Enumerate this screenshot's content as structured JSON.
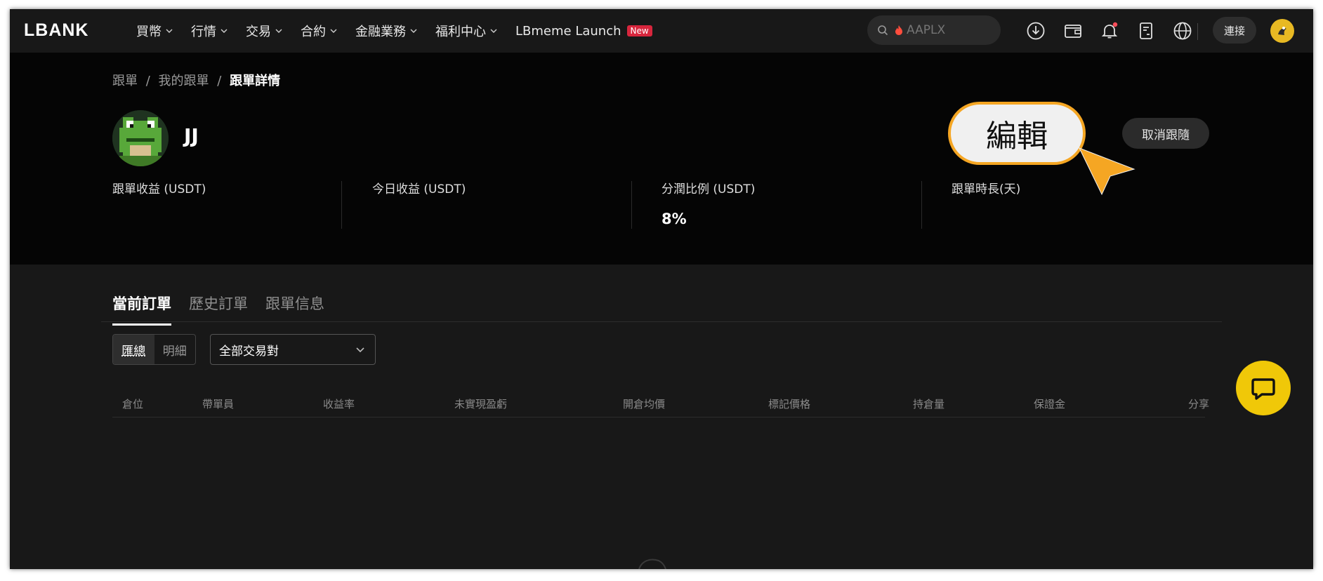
{
  "nav": {
    "logo": "LBANK",
    "menu": [
      {
        "label": "買幣",
        "has_dropdown": true
      },
      {
        "label": "行情",
        "has_dropdown": true
      },
      {
        "label": "交易",
        "has_dropdown": true
      },
      {
        "label": "合約",
        "has_dropdown": true
      },
      {
        "label": "金融業務",
        "has_dropdown": true
      },
      {
        "label": "福利中心",
        "has_dropdown": true
      },
      {
        "label": "LBmeme Launch",
        "has_dropdown": false,
        "badge": "New"
      }
    ],
    "search_placeholder": "AAPLX",
    "connect_label": "連接",
    "icons": [
      "download-icon",
      "wallet-icon",
      "bell-icon",
      "document-icon",
      "globe-icon"
    ]
  },
  "breadcrumb": {
    "items": [
      "跟單",
      "我的跟單",
      "跟單詳情"
    ],
    "separator": "/"
  },
  "trader": {
    "name": "JJ"
  },
  "actions": {
    "edit_label": "編輯",
    "unfollow_label": "取消跟隨"
  },
  "stats": [
    {
      "label": "跟單收益 (USDT)",
      "value": ""
    },
    {
      "label": "今日收益 (USDT)",
      "value": ""
    },
    {
      "label": "分潤比例 (USDT)",
      "value": "8%"
    },
    {
      "label": "跟單時長(天)",
      "value": ""
    }
  ],
  "tabs": [
    {
      "label": "當前訂單",
      "active": true
    },
    {
      "label": "歷史訂單",
      "active": false
    },
    {
      "label": "跟單信息",
      "active": false
    }
  ],
  "view_toggle": [
    {
      "label": "匯總",
      "active": true
    },
    {
      "label": "明細",
      "active": false
    }
  ],
  "pair_select": {
    "value": "全部交易對"
  },
  "table": {
    "columns": [
      "倉位",
      "帶單員",
      "收益率",
      "未實現盈虧",
      "開倉均價",
      "標記價格",
      "持倉量",
      "保證金",
      "分享"
    ]
  },
  "colors": {
    "accent_yellow": "#f0c808",
    "callout_border": "#f5a623",
    "new_badge": "#d7263d",
    "background": "#111111"
  }
}
